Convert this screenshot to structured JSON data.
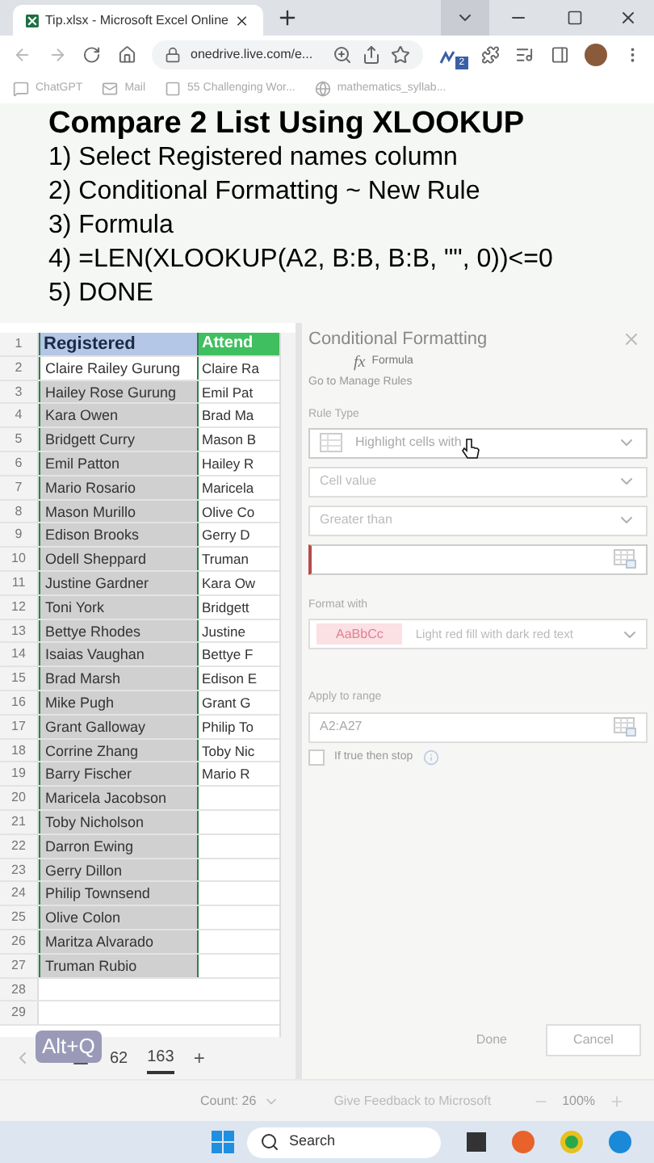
{
  "browser": {
    "tab_title": "Tip.xlsx - Microsoft Excel Online",
    "url": "onedrive.live.com/e...",
    "extension_badge": "2",
    "bookmarks": [
      "ChatGPT",
      "Mail",
      "55 Challenging Wor...",
      "mathematics_syllab..."
    ]
  },
  "overlay": {
    "title": "Compare 2 List Using XLOOKUP",
    "steps": [
      "1) Select Registered names column",
      "2) Conditional Formatting ~ New Rule",
      "3) Formula",
      "4) =LEN(XLOOKUP(A2, B:B, B:B, \"\", 0))<=0",
      "5) DONE"
    ]
  },
  "sheet": {
    "rows": [
      {
        "num": "1",
        "a": "Registered",
        "b": "Attend",
        "kind": "header"
      },
      {
        "num": "2",
        "a": "Claire Railey Gurung",
        "b": "Claire Ra",
        "selected": false
      },
      {
        "num": "3",
        "a": "Hailey Rose Gurung",
        "b": "Emil Pat",
        "selected": true
      },
      {
        "num": "4",
        "a": "Kara Owen",
        "b": "Brad Ma",
        "selected": true
      },
      {
        "num": "5",
        "a": "Bridgett Curry",
        "b": "Mason B",
        "selected": true
      },
      {
        "num": "6",
        "a": "Emil Patton",
        "b": "Hailey R",
        "selected": true
      },
      {
        "num": "7",
        "a": "Mario Rosario",
        "b": "Maricela",
        "selected": true
      },
      {
        "num": "8",
        "a": "Mason Murillo",
        "b": "Olive Co",
        "selected": true
      },
      {
        "num": "9",
        "a": "Edison Brooks",
        "b": "Gerry D",
        "selected": true
      },
      {
        "num": "10",
        "a": "Odell Sheppard",
        "b": "Truman",
        "selected": true
      },
      {
        "num": "11",
        "a": "Justine Gardner",
        "b": "Kara Ow",
        "selected": true
      },
      {
        "num": "12",
        "a": "Toni York",
        "b": "Bridgett",
        "selected": true
      },
      {
        "num": "13",
        "a": "Bettye Rhodes",
        "b": "Justine",
        "selected": true
      },
      {
        "num": "14",
        "a": "Isaias Vaughan",
        "b": "Bettye F",
        "selected": true
      },
      {
        "num": "15",
        "a": "Brad Marsh",
        "b": "Edison E",
        "selected": true
      },
      {
        "num": "16",
        "a": "Mike Pugh",
        "b": "Grant G",
        "selected": true
      },
      {
        "num": "17",
        "a": "Grant Galloway",
        "b": "Philip To",
        "selected": true
      },
      {
        "num": "18",
        "a": "Corrine Zhang",
        "b": "Toby Nic",
        "selected": true
      },
      {
        "num": "19",
        "a": "Barry Fischer",
        "b": "Mario R",
        "selected": true
      },
      {
        "num": "20",
        "a": "Maricela Jacobson",
        "selected": true
      },
      {
        "num": "21",
        "a": "Toby Nicholson",
        "selected": true
      },
      {
        "num": "22",
        "a": "Darron Ewing",
        "selected": true
      },
      {
        "num": "23",
        "a": "Gerry Dillon",
        "selected": true
      },
      {
        "num": "24",
        "a": "Philip Townsend",
        "selected": true
      },
      {
        "num": "25",
        "a": "Olive Colon",
        "selected": true
      },
      {
        "num": "26",
        "a": "Maritza Alvarado",
        "selected": true
      },
      {
        "num": "27",
        "a": "Truman Rubio",
        "selected": true
      },
      {
        "num": "28"
      },
      {
        "num": "29"
      }
    ],
    "tabs": [
      {
        "label": "62",
        "selected": false
      },
      {
        "label": "163",
        "selected": true
      }
    ],
    "add_tab": "+",
    "shortcut": "Alt+Q"
  },
  "panel": {
    "title": "Conditional Formatting",
    "formula_icon": "fx",
    "menu_item": "Formula",
    "link": "Go to Manage Rules",
    "rule_type_label": "Rule Type",
    "rule_type": "Highlight cells with",
    "condition": "Cell value",
    "operator": "Greater than",
    "format_label": "Format with",
    "format_preview": "AaBbCc",
    "format": "Light red fill with dark red text",
    "range_label": "Apply to range",
    "range": "A2:A27",
    "stop": {
      "label": "If true then stop",
      "checked": false
    },
    "done": {
      "label": "Done",
      "disabled": true
    },
    "cancel": "Cancel"
  },
  "status_bar": {
    "count": "Count: 26",
    "feedback": "Give Feedback to Microsoft",
    "zoom": "100%"
  },
  "taskbar": {
    "search": "Search"
  }
}
